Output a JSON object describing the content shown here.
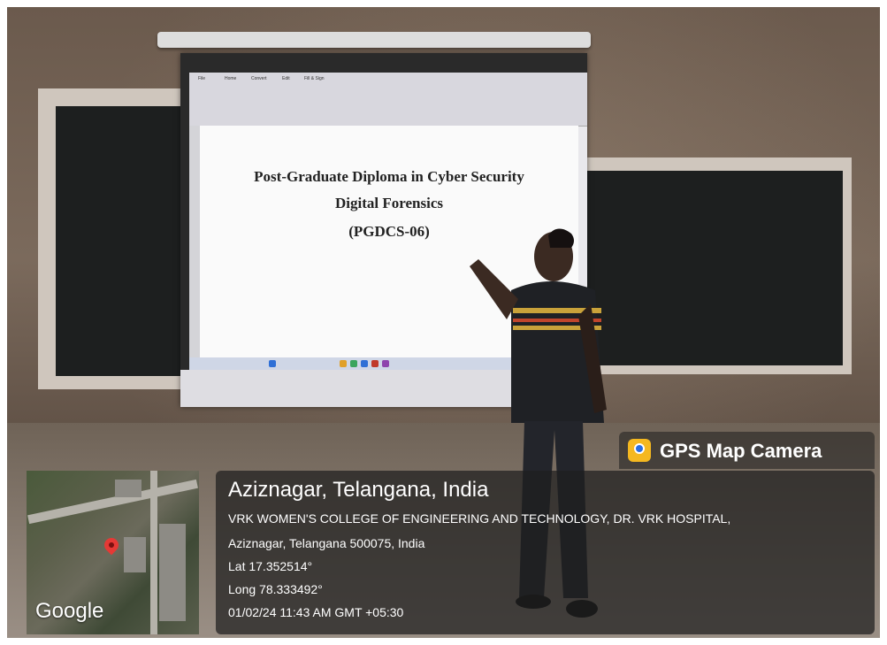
{
  "slide": {
    "line1": "Post-Graduate Diploma in Cyber Security",
    "line2": "Digital Forensics",
    "line3": "(PGDCS-06)"
  },
  "gps_badge": {
    "label": "GPS Map Camera",
    "icon": "map-pin-camera-icon"
  },
  "map": {
    "brand": "Google",
    "icon": "location-pin-icon",
    "pin_color": "#e53935"
  },
  "location": {
    "title": "Aziznagar, Telangana, India",
    "address_line1": "VRK WOMEN'S COLLEGE OF ENGINEERING AND TECHNOLOGY, DR. VRK HOSPITAL,",
    "address_line2": "Aziznagar, Telangana 500075, India",
    "latitude": "Lat 17.352514°",
    "longitude": "Long 78.333492°",
    "timestamp": "01/02/24 11:43 AM GMT +05:30"
  }
}
